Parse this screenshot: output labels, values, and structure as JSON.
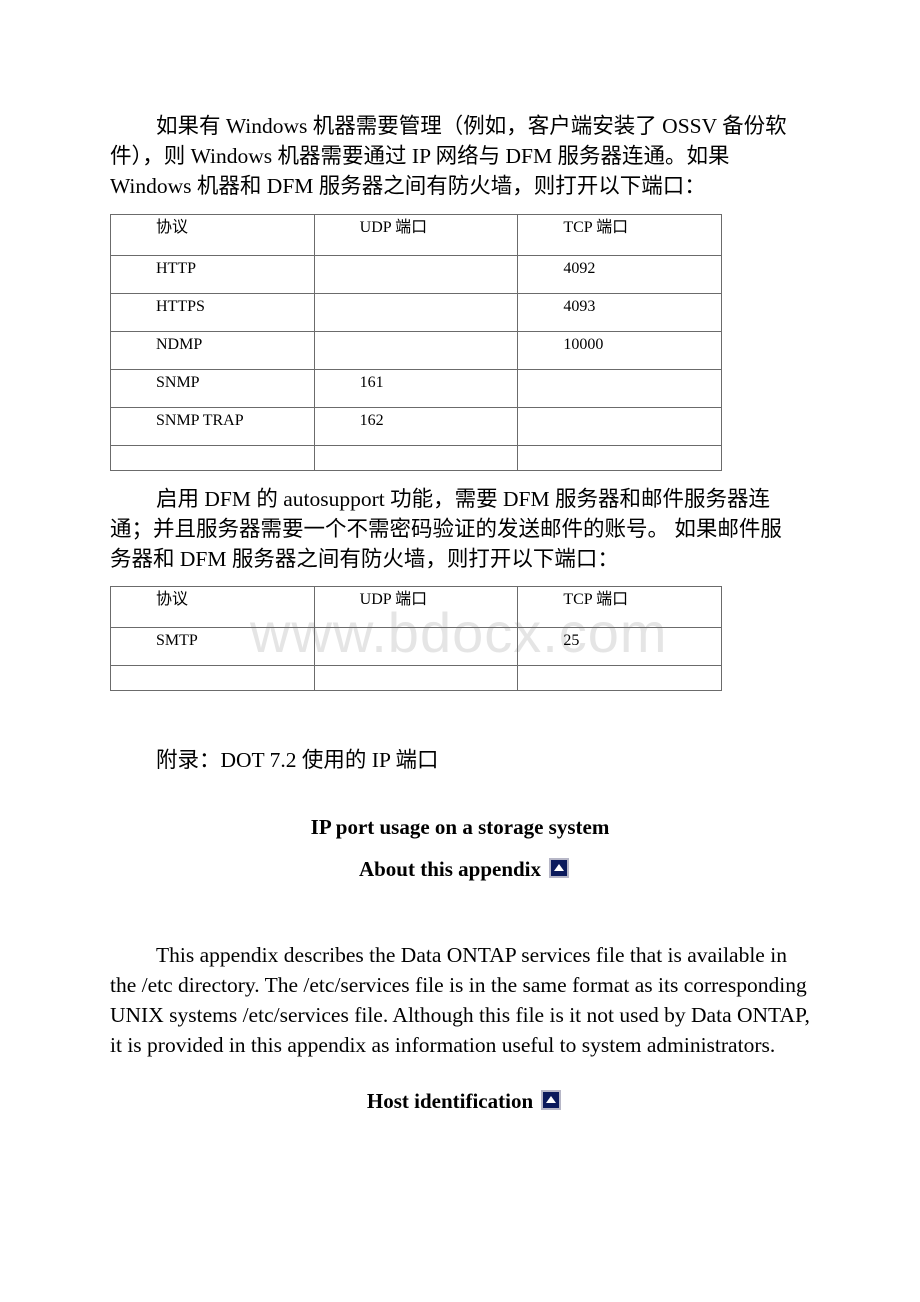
{
  "intro_paragraph": "如果有 Windows 机器需要管理（例如，客户端安装了 OSSV 备份软件），则 Windows 机器需要通过 IP 网络与 DFM 服务器连通。如果 Windows 机器和 DFM 服务器之间有防火墙，则打开以下端口：",
  "table1": {
    "headers": [
      "协议",
      "UDP 端口",
      "TCP 端口"
    ],
    "rows": [
      [
        "HTTP",
        "",
        "4092"
      ],
      [
        "HTTPS",
        "",
        "4093"
      ],
      [
        "NDMP",
        "",
        "10000"
      ],
      [
        "SNMP",
        "161",
        ""
      ],
      [
        "SNMP TRAP",
        "162",
        ""
      ],
      [
        "",
        "",
        ""
      ]
    ]
  },
  "autosupport_paragraph": "启用 DFM 的 autosupport 功能，需要 DFM 服务器和邮件服务器连通；并且服务器需要一个不需密码验证的发送邮件的账号。 如果邮件服务器和 DFM 服务器之间有防火墙，则打开以下端口：",
  "table2": {
    "headers": [
      "协议",
      "UDP 端口",
      "TCP 端口"
    ],
    "rows": [
      [
        "SMTP",
        "",
        "25"
      ],
      [
        "",
        "",
        ""
      ]
    ]
  },
  "appendix_label": "附录：DOT 7.2 使用的 IP 端口",
  "heading_ip_port_usage": "IP port usage on a storage system",
  "heading_about": "About this appendix",
  "about_paragraph": "This appendix describes the Data ONTAP services file that is available in the /etc directory. The /etc/services file is in the same format as its corresponding UNIX systems /etc/services file. Although this file is it not used by Data ONTAP, it is provided in this appendix as information useful to system administrators.",
  "heading_host": "Host identification",
  "watermark": "www.bdocx.com",
  "icons": {
    "back_to_top": "up-arrow-icon"
  }
}
